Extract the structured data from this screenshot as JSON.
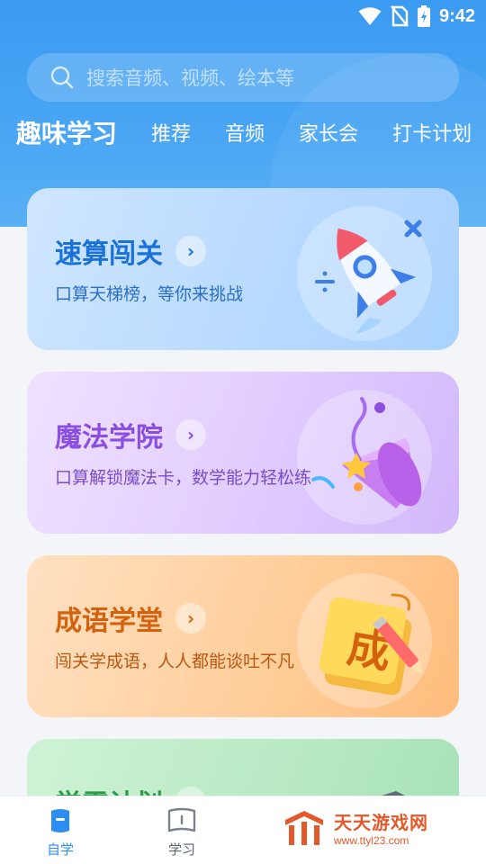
{
  "status": {
    "time": "9:42"
  },
  "search": {
    "placeholder": "搜索音频、视频、绘本等"
  },
  "tabs": [
    "趣味学习",
    "推荐",
    "音频",
    "家长会",
    "打卡计划"
  ],
  "cards": [
    {
      "title": "速算闯关",
      "subtitle": "口算天梯榜，等你来挑战",
      "icon": "rocket-icon"
    },
    {
      "title": "魔法学院",
      "subtitle": "口算解锁魔法卡，数学能力轻松练",
      "icon": "party-popper-icon"
    },
    {
      "title": "成语学堂",
      "subtitle": "闯关学成语，人人都能谈吐不凡",
      "icon": "notebook-pencil-icon",
      "badge_char": "成"
    },
    {
      "title": "学霸计划",
      "subtitle": "",
      "icon": "graduation-cap-icon"
    }
  ],
  "bottom_nav": [
    {
      "label": "自学",
      "icon": "self-study-icon",
      "active": true
    },
    {
      "label": "学习",
      "icon": "book-icon",
      "active": false
    }
  ],
  "watermark": {
    "title": "天天游戏网",
    "url": "www.ttyl23.com"
  },
  "colors": {
    "primary": "#3b9bf2",
    "nav_active": "#2c8df3",
    "watermark": "#e4592a"
  }
}
